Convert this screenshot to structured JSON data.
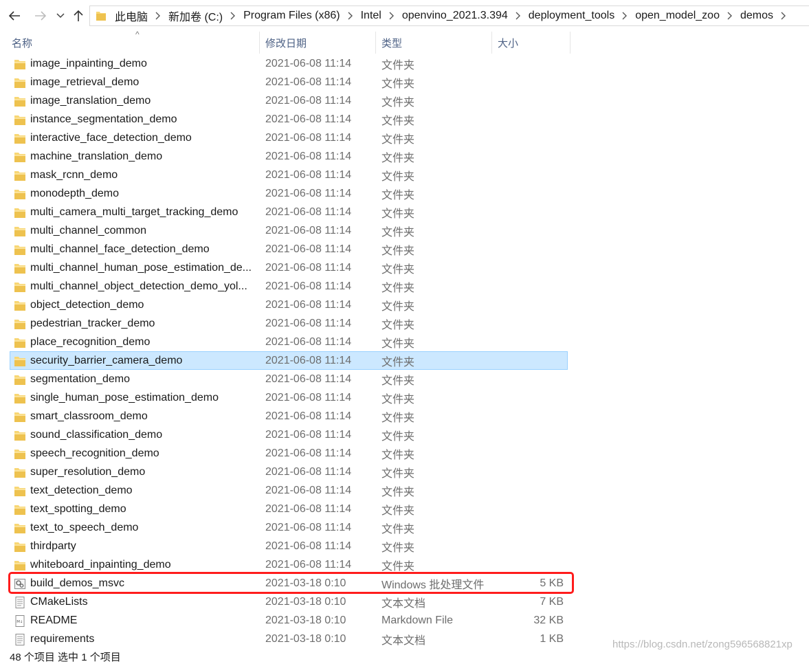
{
  "address": {
    "crumbs": [
      "此电脑",
      "新加卷 (C:)",
      "Program Files (x86)",
      "Intel",
      "openvino_2021.3.394",
      "deployment_tools",
      "open_model_zoo",
      "demos"
    ]
  },
  "columns": {
    "name": "名称",
    "date": "修改日期",
    "type": "类型",
    "size": "大小"
  },
  "files": [
    {
      "name": "image_inpainting_demo",
      "date": "2021-06-08 11:14",
      "type": "文件夹",
      "size": "",
      "icon": "folder-icon"
    },
    {
      "name": "image_retrieval_demo",
      "date": "2021-06-08 11:14",
      "type": "文件夹",
      "size": "",
      "icon": "folder-icon"
    },
    {
      "name": "image_translation_demo",
      "date": "2021-06-08 11:14",
      "type": "文件夹",
      "size": "",
      "icon": "folder-icon"
    },
    {
      "name": "instance_segmentation_demo",
      "date": "2021-06-08 11:14",
      "type": "文件夹",
      "size": "",
      "icon": "folder-icon"
    },
    {
      "name": "interactive_face_detection_demo",
      "date": "2021-06-08 11:14",
      "type": "文件夹",
      "size": "",
      "icon": "folder-icon"
    },
    {
      "name": "machine_translation_demo",
      "date": "2021-06-08 11:14",
      "type": "文件夹",
      "size": "",
      "icon": "folder-icon"
    },
    {
      "name": "mask_rcnn_demo",
      "date": "2021-06-08 11:14",
      "type": "文件夹",
      "size": "",
      "icon": "folder-icon"
    },
    {
      "name": "monodepth_demo",
      "date": "2021-06-08 11:14",
      "type": "文件夹",
      "size": "",
      "icon": "folder-icon"
    },
    {
      "name": "multi_camera_multi_target_tracking_demo",
      "date": "2021-06-08 11:14",
      "type": "文件夹",
      "size": "",
      "icon": "folder-icon"
    },
    {
      "name": "multi_channel_common",
      "date": "2021-06-08 11:14",
      "type": "文件夹",
      "size": "",
      "icon": "folder-icon"
    },
    {
      "name": "multi_channel_face_detection_demo",
      "date": "2021-06-08 11:14",
      "type": "文件夹",
      "size": "",
      "icon": "folder-icon"
    },
    {
      "name": "multi_channel_human_pose_estimation_de...",
      "date": "2021-06-08 11:14",
      "type": "文件夹",
      "size": "",
      "icon": "folder-icon"
    },
    {
      "name": "multi_channel_object_detection_demo_yol...",
      "date": "2021-06-08 11:14",
      "type": "文件夹",
      "size": "",
      "icon": "folder-icon"
    },
    {
      "name": "object_detection_demo",
      "date": "2021-06-08 11:14",
      "type": "文件夹",
      "size": "",
      "icon": "folder-icon"
    },
    {
      "name": "pedestrian_tracker_demo",
      "date": "2021-06-08 11:14",
      "type": "文件夹",
      "size": "",
      "icon": "folder-icon"
    },
    {
      "name": "place_recognition_demo",
      "date": "2021-06-08 11:14",
      "type": "文件夹",
      "size": "",
      "icon": "folder-icon"
    },
    {
      "name": "security_barrier_camera_demo",
      "date": "2021-06-08 11:14",
      "type": "文件夹",
      "size": "",
      "icon": "folder-icon",
      "selected": true
    },
    {
      "name": "segmentation_demo",
      "date": "2021-06-08 11:14",
      "type": "文件夹",
      "size": "",
      "icon": "folder-icon"
    },
    {
      "name": "single_human_pose_estimation_demo",
      "date": "2021-06-08 11:14",
      "type": "文件夹",
      "size": "",
      "icon": "folder-icon"
    },
    {
      "name": "smart_classroom_demo",
      "date": "2021-06-08 11:14",
      "type": "文件夹",
      "size": "",
      "icon": "folder-icon"
    },
    {
      "name": "sound_classification_demo",
      "date": "2021-06-08 11:14",
      "type": "文件夹",
      "size": "",
      "icon": "folder-icon"
    },
    {
      "name": "speech_recognition_demo",
      "date": "2021-06-08 11:14",
      "type": "文件夹",
      "size": "",
      "icon": "folder-icon"
    },
    {
      "name": "super_resolution_demo",
      "date": "2021-06-08 11:14",
      "type": "文件夹",
      "size": "",
      "icon": "folder-icon"
    },
    {
      "name": "text_detection_demo",
      "date": "2021-06-08 11:14",
      "type": "文件夹",
      "size": "",
      "icon": "folder-icon"
    },
    {
      "name": "text_spotting_demo",
      "date": "2021-06-08 11:14",
      "type": "文件夹",
      "size": "",
      "icon": "folder-icon"
    },
    {
      "name": "text_to_speech_demo",
      "date": "2021-06-08 11:14",
      "type": "文件夹",
      "size": "",
      "icon": "folder-icon"
    },
    {
      "name": "thirdparty",
      "date": "2021-06-08 11:14",
      "type": "文件夹",
      "size": "",
      "icon": "folder-icon"
    },
    {
      "name": "whiteboard_inpainting_demo",
      "date": "2021-06-08 11:14",
      "type": "文件夹",
      "size": "",
      "icon": "folder-icon"
    },
    {
      "name": "build_demos_msvc",
      "date": "2021-03-18 0:10",
      "type": "Windows 批处理文件",
      "size": "5 KB",
      "icon": "batch-file-icon",
      "highlighted": true
    },
    {
      "name": "CMakeLists",
      "date": "2021-03-18 0:10",
      "type": "文本文档",
      "size": "7 KB",
      "icon": "text-file-icon"
    },
    {
      "name": "README",
      "date": "2021-03-18 0:10",
      "type": "Markdown File",
      "size": "32 KB",
      "icon": "markdown-file-icon"
    },
    {
      "name": "requirements",
      "date": "2021-03-18 0:10",
      "type": "文本文档",
      "size": "1 KB",
      "icon": "text-file-icon"
    }
  ],
  "status": {
    "text": "48 个项目    选中 1 个项目"
  },
  "watermark": "https://blog.csdn.net/zong596568821xp",
  "colors": {
    "selection": "#cce8ff",
    "selection_border": "#99d1ff",
    "highlight_box": "#ff1c1c",
    "folder": "#f8d775",
    "header_text": "#4d6185"
  }
}
